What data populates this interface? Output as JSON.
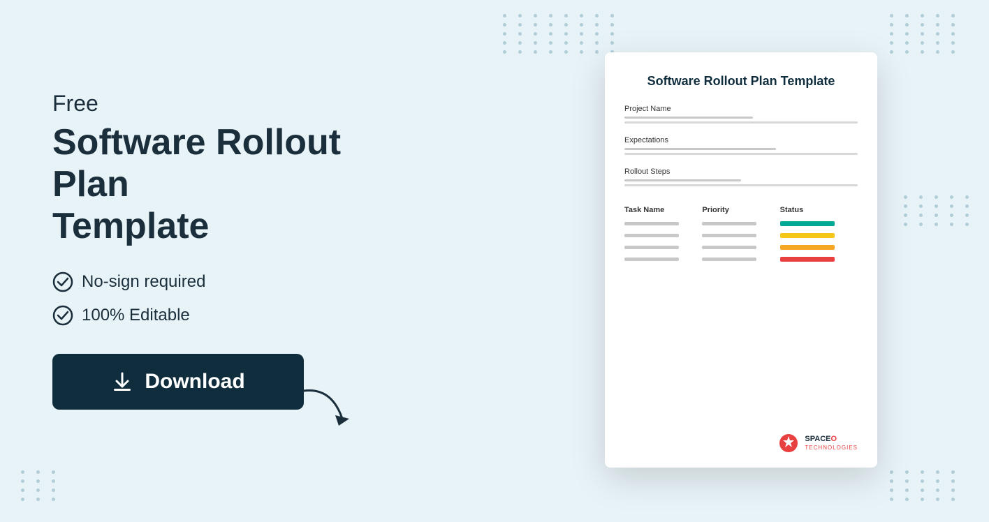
{
  "page": {
    "background_color": "#e8f3f7"
  },
  "left": {
    "free_label": "Free",
    "title_line1": "Software Rollout Plan",
    "title_line2": "Template",
    "features": [
      {
        "id": "no-sign",
        "text": "No-sign required"
      },
      {
        "id": "editable",
        "text": "100% Editable"
      }
    ],
    "download_button": "Download"
  },
  "document": {
    "title": "Software Rollout Plan Template",
    "sections": [
      {
        "id": "project-name",
        "label": "Project Name"
      },
      {
        "id": "expectations",
        "label": "Expectations"
      },
      {
        "id": "rollout-steps",
        "label": "Rollout Steps"
      }
    ],
    "table": {
      "headers": [
        "Task Name",
        "Priority",
        "Status"
      ],
      "rows": [
        {
          "status_color": "green"
        },
        {
          "status_color": "yellow"
        },
        {
          "status_color": "orange"
        },
        {
          "status_color": "red"
        }
      ]
    },
    "logo": {
      "company_name": "SPACE",
      "suffix": "O",
      "sub": "TECHNOLOGIES"
    }
  },
  "dots": {
    "count_per_row": 8
  }
}
